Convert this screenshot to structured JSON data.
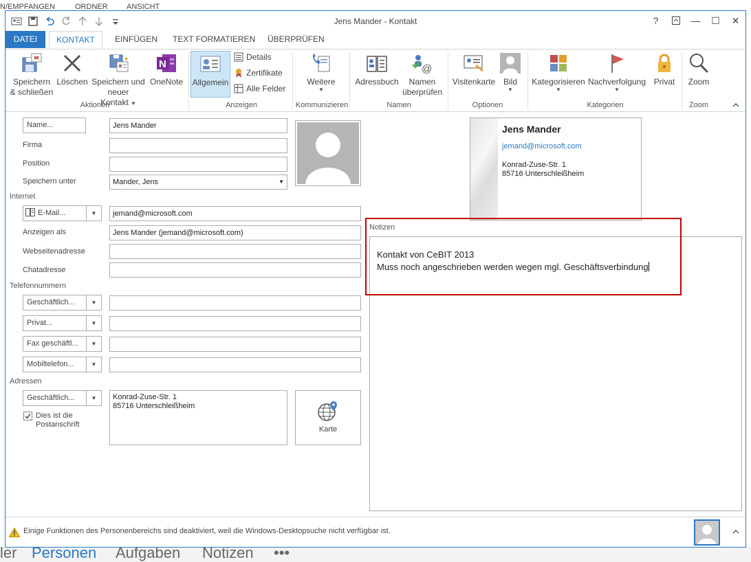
{
  "background": {
    "top_items": [
      "N/EMPFANGEN",
      "ORDNER",
      "ANSICHT"
    ],
    "bottom_nav": [
      "ler",
      "Personen",
      "Aufgaben",
      "Notizen",
      "•••"
    ]
  },
  "window": {
    "title": "Jens Mander - Kontakt",
    "controls": {
      "help": "?",
      "ribbon_options": "↗",
      "minimize": "—",
      "maximize": "☐",
      "close": "✕"
    }
  },
  "tabs": [
    "DATEI",
    "KONTAKT",
    "EINFÜGEN",
    "TEXT FORMATIEREN",
    "ÜBERPRÜFEN"
  ],
  "ribbon": {
    "save_close": [
      "Speichern",
      "& schließen"
    ],
    "delete": "Löschen",
    "save_new": [
      "Speichern und",
      "neuer Kontakt"
    ],
    "onenote": "OneNote",
    "general": "Allgemein",
    "details": "Details",
    "certificates": "Zertifikate",
    "all_fields": "Alle Felder",
    "more": "Weitere",
    "address_book": "Adressbuch",
    "check_names": [
      "Namen",
      "überprüfen"
    ],
    "business_card": "Visitenkarte",
    "picture": "Bild",
    "categorize": "Kategorisieren",
    "follow_up": "Nachverfolgung",
    "private": "Privat",
    "zoom": "Zoom",
    "groups": [
      "Aktionen",
      "Anzeigen",
      "Kommunizieren",
      "Namen",
      "Optionen",
      "Kategorien",
      "Zoom"
    ]
  },
  "form": {
    "name_btn": "Name...",
    "name_value": "Jens Mander",
    "company_label": "Firma",
    "company_value": "",
    "position_label": "Position",
    "position_value": "",
    "file_as_label": "Speichern unter",
    "file_as_value": "Mander, Jens",
    "internet_section": "Internet",
    "email_btn": "E-Mail...",
    "email_value": "jemand@microsoft.com",
    "display_as_label": "Anzeigen als",
    "display_as_value": "Jens Mander (jemand@microsoft.com)",
    "web_label": "Webseitenadresse",
    "web_value": "",
    "im_label": "Chatadresse",
    "im_value": "",
    "phone_section": "Telefonnummern",
    "phones": [
      "Geschäftlich...",
      "Privat...",
      "Fax geschäftl...",
      "Mobiltelefon..."
    ],
    "address_section": "Adressen",
    "address_btn": "Geschäftlich...",
    "address_line1": "Konrad-Zuse-Str. 1",
    "address_line2": "85716 Unterschleißheim",
    "mailing_line1": "Dies ist die",
    "mailing_line2": "Postanschrift",
    "map_label": "Karte"
  },
  "card": {
    "name": "Jens Mander",
    "email": "jemand@microsoft.com",
    "addr1": "Konrad-Zuse-Str. 1",
    "addr2": "85716 Unterschleißheim"
  },
  "notes": {
    "label": "Notizen",
    "line1": "Kontakt von CeBIT 2013",
    "line2": "Muss noch angeschrieben werden wegen mgl. Geschäftsverbindung"
  },
  "status": {
    "text": "Einige Funktionen des Personenbereichs sind deaktiviert, weil die Windows-Desktopsuche nicht verfügbar ist.",
    "expand": "˄"
  }
}
